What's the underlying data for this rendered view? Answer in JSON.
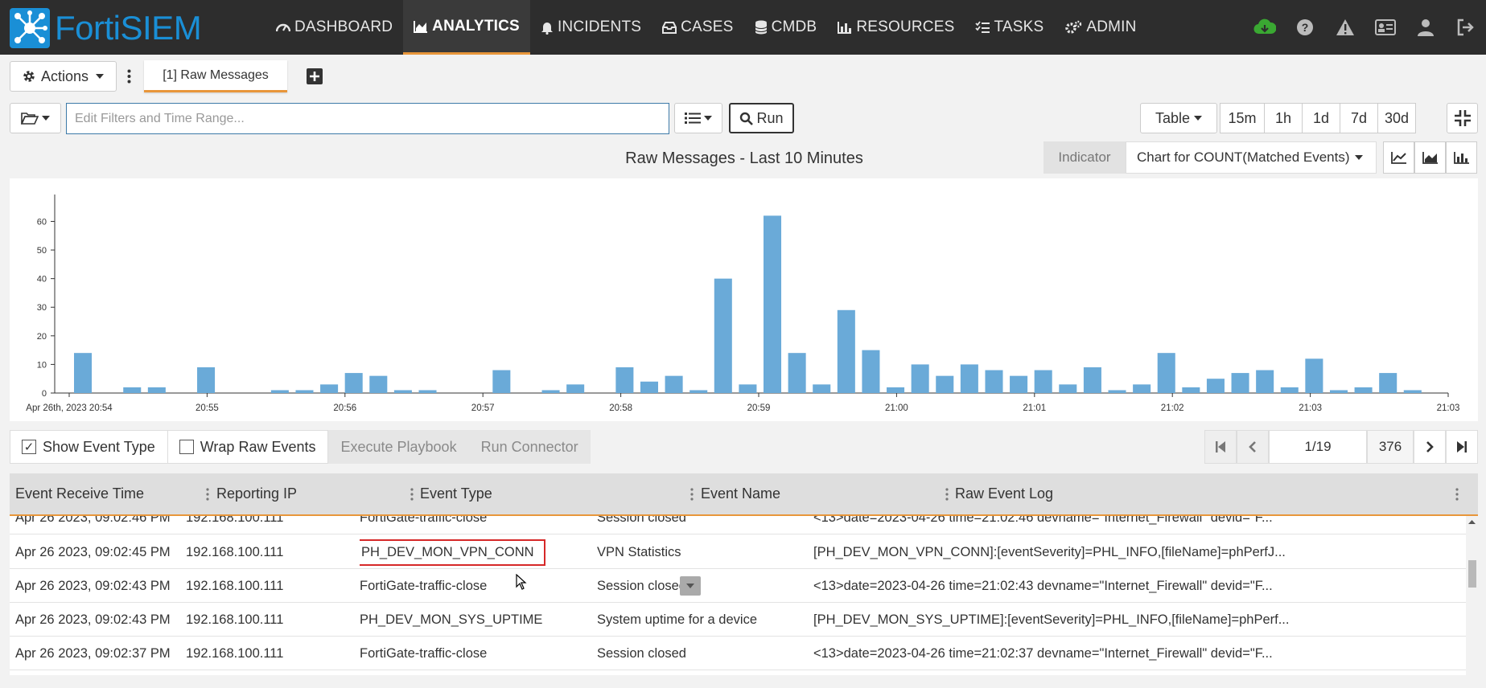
{
  "app": {
    "logo_text": "FortiSIEM"
  },
  "nav": [
    {
      "label": "DASHBOARD",
      "icon": "gauge-icon",
      "active": false
    },
    {
      "label": "ANALYTICS",
      "icon": "area-chart-icon",
      "active": true
    },
    {
      "label": "INCIDENTS",
      "icon": "bell-icon",
      "active": false
    },
    {
      "label": "CASES",
      "icon": "inbox-icon",
      "active": false
    },
    {
      "label": "CMDB",
      "icon": "database-icon",
      "active": false
    },
    {
      "label": "RESOURCES",
      "icon": "bar-chart-icon",
      "active": false
    },
    {
      "label": "TASKS",
      "icon": "tasks-icon",
      "active": false
    },
    {
      "label": "ADMIN",
      "icon": "gears-icon",
      "active": false
    }
  ],
  "nav_right_icons": [
    "cloud-download-icon",
    "help-icon",
    "warning-icon",
    "id-card-icon",
    "user-icon",
    "sign-out-icon"
  ],
  "toolbar": {
    "actions_label": "Actions",
    "tab_label": "[1] Raw Messages",
    "filter_placeholder": "Edit Filters and Time Range...",
    "run_label": "Run",
    "view_label": "Table",
    "time_ranges": [
      "15m",
      "1h",
      "1d",
      "7d",
      "30d"
    ]
  },
  "chart_header": {
    "title": "Raw Messages - Last 10 Minutes",
    "indicator_label": "Indicator",
    "indicator_value": "Chart for COUNT(Matched Events)"
  },
  "chart_data": {
    "type": "bar",
    "title": "Raw Messages - Last 10 Minutes",
    "ylim": [
      0,
      68
    ],
    "yticks": [
      0,
      10,
      20,
      30,
      40,
      50,
      60
    ],
    "xticks": [
      {
        "label": "Apr 26th, 2023 20:54",
        "t": 0
      },
      {
        "label": "20:55",
        "t": 1
      },
      {
        "label": "20:56",
        "t": 2
      },
      {
        "label": "20:57",
        "t": 3
      },
      {
        "label": "20:58",
        "t": 4
      },
      {
        "label": "20:59",
        "t": 5
      },
      {
        "label": "21:00",
        "t": 6
      },
      {
        "label": "21:01",
        "t": 7
      },
      {
        "label": "21:02",
        "t": 8
      },
      {
        "label": "21:03",
        "t": 9
      },
      {
        "label": "21:03",
        "t": 10
      }
    ],
    "series": [
      {
        "values": [
          14,
          0,
          2,
          2,
          0,
          9,
          0,
          0,
          1,
          1,
          3,
          7,
          6,
          1,
          1,
          0,
          0,
          8,
          0,
          1,
          3,
          0,
          9,
          4,
          6,
          1,
          40,
          3,
          62,
          14,
          3,
          29,
          15,
          2,
          10,
          6,
          10,
          8,
          6,
          8,
          3,
          9,
          1,
          3,
          14,
          2,
          5,
          7,
          8,
          2,
          12,
          1,
          2,
          7,
          1,
          0
        ]
      }
    ],
    "bar_color": "#6aaad8"
  },
  "table_controls": {
    "show_event_type": "Show Event Type",
    "wrap_raw_events": "Wrap Raw Events",
    "execute_playbook": "Execute Playbook",
    "run_connector": "Run Connector"
  },
  "pager": {
    "page": "1/19",
    "total": "376"
  },
  "table": {
    "columns": [
      "Event Receive Time",
      "Reporting IP",
      "Event Type",
      "Event Name",
      "Raw Event Log"
    ],
    "rows": [
      [
        "Apr 26 2023, 09:02:46 PM",
        "192.168.100.111",
        "FortiGate-traffic-close",
        "Session closed",
        "<13>date=2023-04-26 time=21:02:46 devname=\"Internet_Firewall\" devid=\"F..."
      ],
      [
        "Apr 26 2023, 09:02:45 PM",
        "192.168.100.111",
        "PH_DEV_MON_VPN_CONN",
        "VPN Statistics",
        "[PH_DEV_MON_VPN_CONN]:[eventSeverity]=PHL_INFO,[fileName]=phPerfJ..."
      ],
      [
        "Apr 26 2023, 09:02:43 PM",
        "192.168.100.111",
        "FortiGate-traffic-close",
        "Session closed",
        "<13>date=2023-04-26 time=21:02:43 devname=\"Internet_Firewall\" devid=\"F..."
      ],
      [
        "Apr 26 2023, 09:02:43 PM",
        "192.168.100.111",
        "PH_DEV_MON_SYS_UPTIME",
        "System uptime for a device",
        "[PH_DEV_MON_SYS_UPTIME]:[eventSeverity]=PHL_INFO,[fileName]=phPerf..."
      ],
      [
        "Apr 26 2023, 09:02:37 PM",
        "192.168.100.111",
        "FortiGate-traffic-close",
        "Session closed",
        "<13>date=2023-04-26 time=21:02:37 devname=\"Internet_Firewall\" devid=\"F..."
      ]
    ],
    "highlighted_cell": "PH_DEV_MON_VPN_CONN"
  }
}
